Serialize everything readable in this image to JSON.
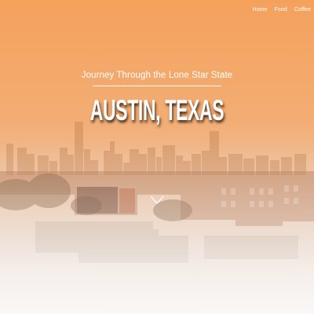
{
  "nav": {
    "items": [
      "Home",
      "Food",
      "Coffee"
    ]
  },
  "hero": {
    "subtitle": "Journey Through the Lone Star State",
    "title": "AUSTIN, TEXAS"
  },
  "scroll_icon": "chevron-down-icon",
  "colors": {
    "overlay_top": "#f4a15c",
    "overlay_bottom": "#f8f6f5",
    "text": "#ffffff"
  }
}
